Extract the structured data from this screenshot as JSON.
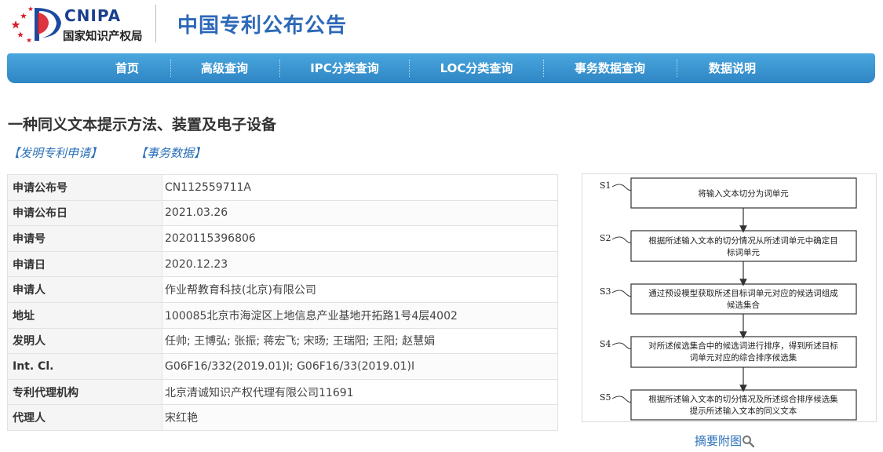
{
  "header": {
    "logo_text": "CNIPA",
    "logo_subtext": "国家知识产权局",
    "site_title": "中国专利公布公告"
  },
  "nav": {
    "items": [
      "首页",
      "高级查询",
      "IPC分类查询",
      "LOC分类查询",
      "事务数据查询",
      "数据说明"
    ]
  },
  "patent": {
    "title": "一种同义文本提示方法、装置及电子设备",
    "links": [
      "【发明专利申请】",
      "【事务数据】"
    ],
    "fields": [
      {
        "label": "申请公布号",
        "value": "CN112559711A"
      },
      {
        "label": "申请公布日",
        "value": "2021.03.26"
      },
      {
        "label": "申请号",
        "value": "2020115396806"
      },
      {
        "label": "申请日",
        "value": "2020.12.23"
      },
      {
        "label": "申请人",
        "value": "作业帮教育科技(北京)有限公司"
      },
      {
        "label": "地址",
        "value": "100085北京市海淀区上地信息产业基地开拓路1号4层4002"
      },
      {
        "label": "发明人",
        "value": "任帅; 王博弘; 张振; 蒋宏飞; 宋旸; 王瑞阳; 王阳; 赵慧娟"
      },
      {
        "label": "Int. Cl.",
        "value": "G06F16/332(2019.01)I; G06F16/33(2019.01)I"
      },
      {
        "label": "专利代理机构",
        "value": "北京清诚知识产权代理有限公司11691"
      },
      {
        "label": "代理人",
        "value": "宋红艳"
      }
    ]
  },
  "figure": {
    "steps": [
      {
        "id": "S1",
        "lines": [
          "将输入文本切分为词单元"
        ]
      },
      {
        "id": "S2",
        "lines": [
          "根据所述输入文本的切分情况从所述词单元中确定目",
          "标词单元"
        ]
      },
      {
        "id": "S3",
        "lines": [
          "通过预设模型获取所述目标词单元对应的候选词组成",
          "候选集合"
        ]
      },
      {
        "id": "S4",
        "lines": [
          "对所述候选集合中的候选词进行排序，得到所述目标",
          "词单元对应的综合排序候选集"
        ]
      },
      {
        "id": "S5",
        "lines": [
          "根据所述输入文本的切分情况及所述综合排序候选集",
          "提示所述输入文本的同义文本"
        ]
      }
    ],
    "link_label": "摘要附图"
  },
  "colors": {
    "brand_blue": "#2d69b8",
    "nav_blue": "#3796d2",
    "logo_red": "#d7202a",
    "link_blue": "#2a6fb8"
  }
}
